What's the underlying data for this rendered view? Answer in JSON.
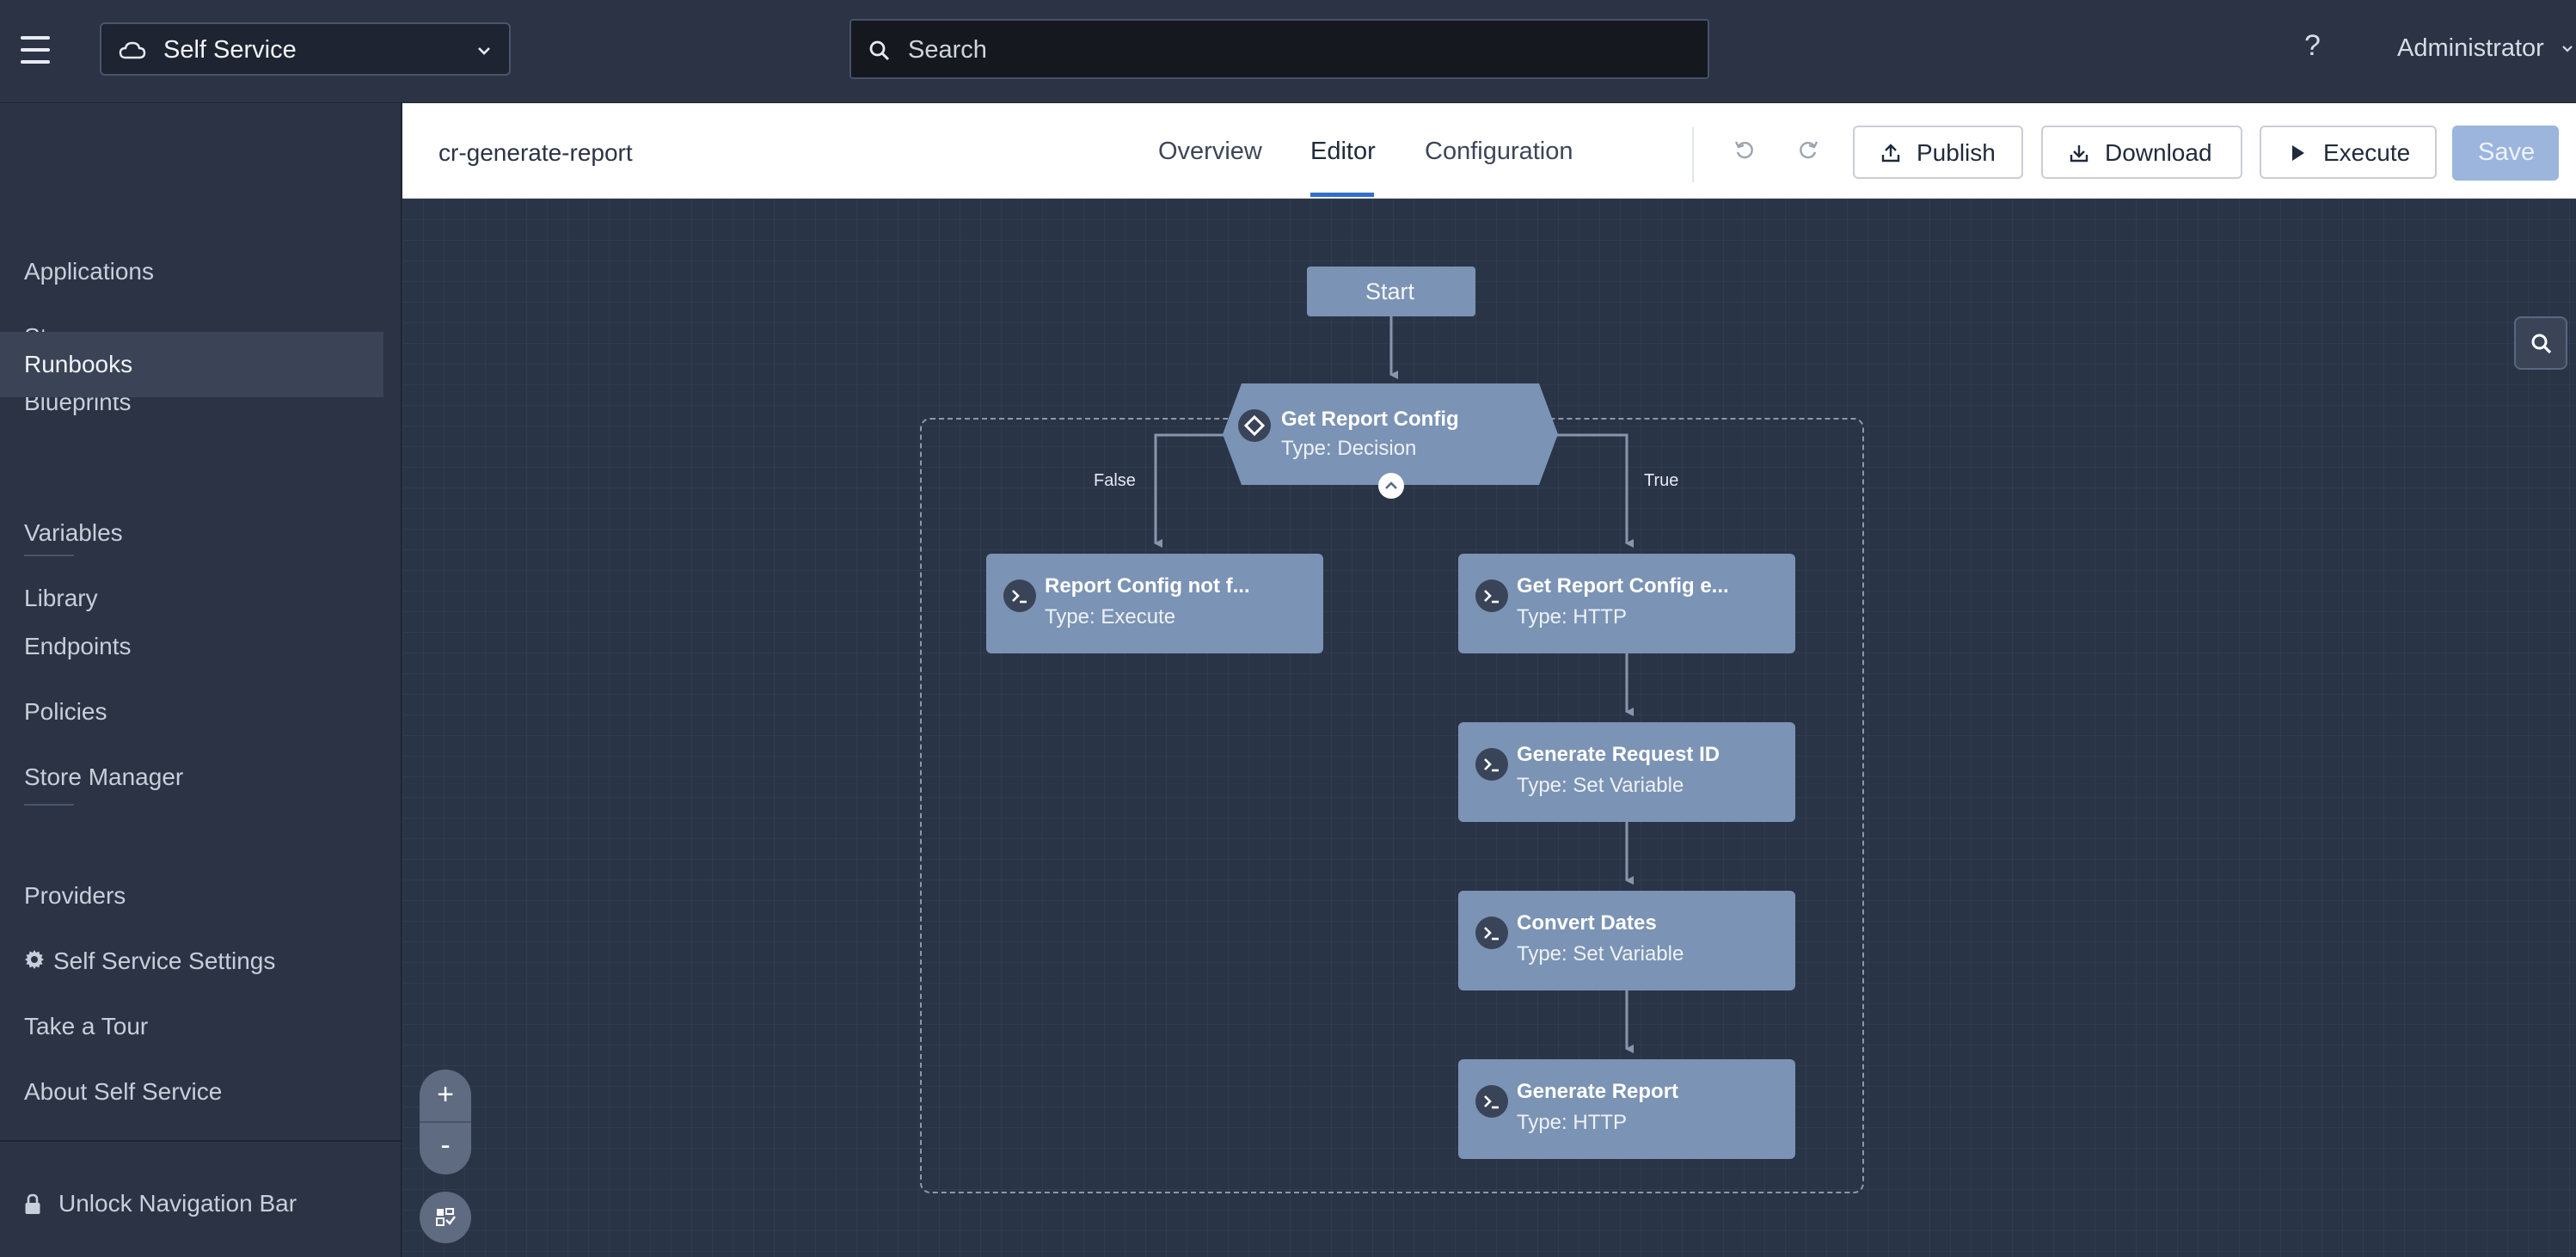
{
  "topbar": {
    "app_name": "Self Service",
    "search_placeholder": "Search",
    "help": "?",
    "user": "Administrator"
  },
  "sidebar": {
    "items": [
      {
        "label": "Applications"
      },
      {
        "label": "Store"
      },
      {
        "label": "Blueprints"
      },
      {
        "label": "Runbooks",
        "active": true
      },
      {
        "label": "Variables"
      },
      {
        "label": "Library"
      },
      {
        "label": "Endpoints"
      },
      {
        "label": "Policies"
      },
      {
        "label": "Store Manager"
      },
      {
        "label": "Providers"
      },
      {
        "label": "Self Service Settings",
        "icon": "gear-icon"
      },
      {
        "label": "Take a Tour"
      },
      {
        "label": "About Self Service"
      }
    ],
    "unlock_label": "Unlock Navigation Bar"
  },
  "editor": {
    "runbook_name": "cr-generate-report",
    "tabs": [
      {
        "label": "Overview"
      },
      {
        "label": "Editor",
        "active": true
      },
      {
        "label": "Configuration"
      }
    ],
    "actions": {
      "publish": "Publish",
      "download": "Download",
      "execute": "Execute",
      "save": "Save"
    }
  },
  "flow": {
    "start": "Start",
    "decision": {
      "title": "Get Report Config",
      "type": "Type: Decision"
    },
    "edge_false": "False",
    "edge_true": "True",
    "nodes": [
      {
        "title": "Report Config not f...",
        "type": "Type: Execute"
      },
      {
        "title": "Get Report Config e...",
        "type": "Type: HTTP"
      },
      {
        "title": "Generate Request ID",
        "type": "Type: Set Variable"
      },
      {
        "title": "Convert Dates",
        "type": "Type: Set Variable"
      },
      {
        "title": "Generate Report",
        "type": "Type: HTTP"
      }
    ]
  },
  "canvas_controls": {
    "zoom_in": "+",
    "zoom_out": "-"
  },
  "colors": {
    "node": "#7b93b4",
    "background": "#2a3447",
    "accent": "#2f6fc9"
  }
}
